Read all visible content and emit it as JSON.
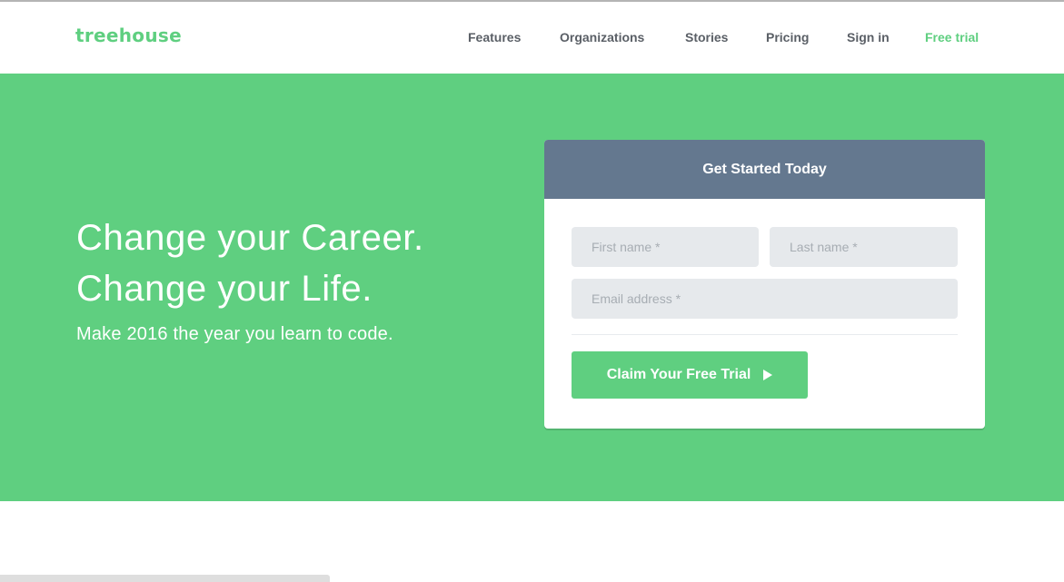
{
  "brand": {
    "logo_text": "treehouse",
    "accent_color": "#5fcf80",
    "header_card_color": "#64788f"
  },
  "nav": {
    "items": [
      {
        "label": "Features"
      },
      {
        "label": "Organizations"
      },
      {
        "label": "Stories"
      },
      {
        "label": "Pricing"
      },
      {
        "label": "Sign in"
      },
      {
        "label": "Free trial"
      }
    ]
  },
  "hero": {
    "headline_line1": "Change your Career.",
    "headline_line2": "Change your Life.",
    "subline": "Make 2016 the year you learn to code."
  },
  "signup": {
    "title": "Get Started Today",
    "first_name_placeholder": "First name *",
    "first_name_value": "",
    "last_name_placeholder": "Last name *",
    "last_name_value": "",
    "email_placeholder": "Email address *",
    "email_value": "",
    "submit_label": "Claim Your Free Trial",
    "submit_icon": "play-icon"
  }
}
